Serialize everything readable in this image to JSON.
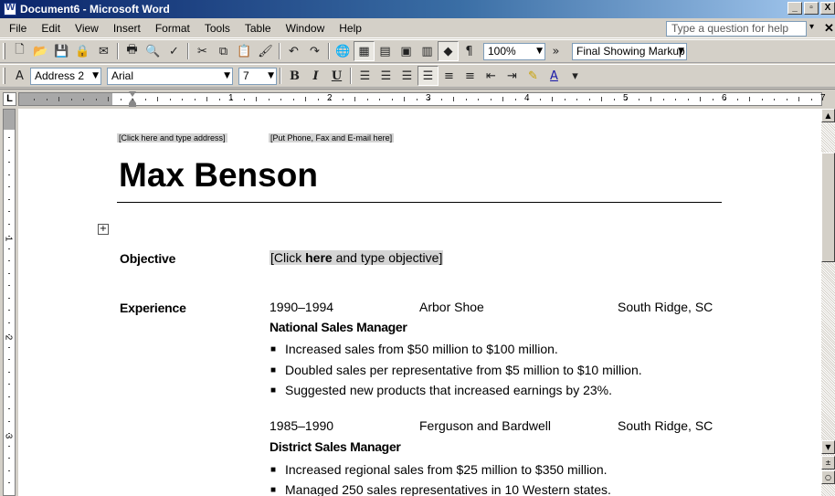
{
  "window": {
    "title": "Document6 - Microsoft Word",
    "minimize": "_",
    "restore": "▫",
    "close": "X"
  },
  "menubar": {
    "items": [
      "File",
      "Edit",
      "View",
      "Insert",
      "Format",
      "Tools",
      "Table",
      "Window",
      "Help"
    ],
    "help_placeholder": "Type a question for help"
  },
  "standard_toolbar": {
    "zoom": "100%",
    "markup_view": "Final Showing Markup"
  },
  "formatting_toolbar": {
    "style": "Address 2",
    "font": "Arial",
    "size": "7"
  },
  "ruler": {
    "numbers": [
      "1",
      "2",
      "3",
      "4",
      "5",
      "6",
      "7"
    ]
  },
  "vertical_ruler": {
    "numbers": [
      "1",
      "2",
      "3"
    ]
  },
  "document": {
    "address_placeholder": "[Click here and type address]",
    "contact_placeholder": "[Put Phone, Fax and E-mail here]",
    "name": "Max Benson",
    "objective_label": "Objective",
    "objective_pre": "[Click ",
    "objective_bold": "here",
    "objective_post": " and type objective]",
    "experience_label": "Experience",
    "jobs": [
      {
        "dates": "1990–1994",
        "company": "Arbor Shoe",
        "location": "South Ridge, SC",
        "title": "National Sales Manager",
        "bullets": [
          "Increased sales from $50 million to $100 million.",
          "Doubled sales per representative from $5 million to $10 million.",
          "Suggested new products that increased earnings by 23%."
        ]
      },
      {
        "dates": "1985–1990",
        "company": "Ferguson and Bardwell",
        "location": "South Ridge, SC",
        "title": "District Sales Manager",
        "bullets": [
          "Increased regional sales from $25 million to $350 million.",
          "Managed 250 sales representatives in 10 Western states."
        ]
      }
    ]
  }
}
